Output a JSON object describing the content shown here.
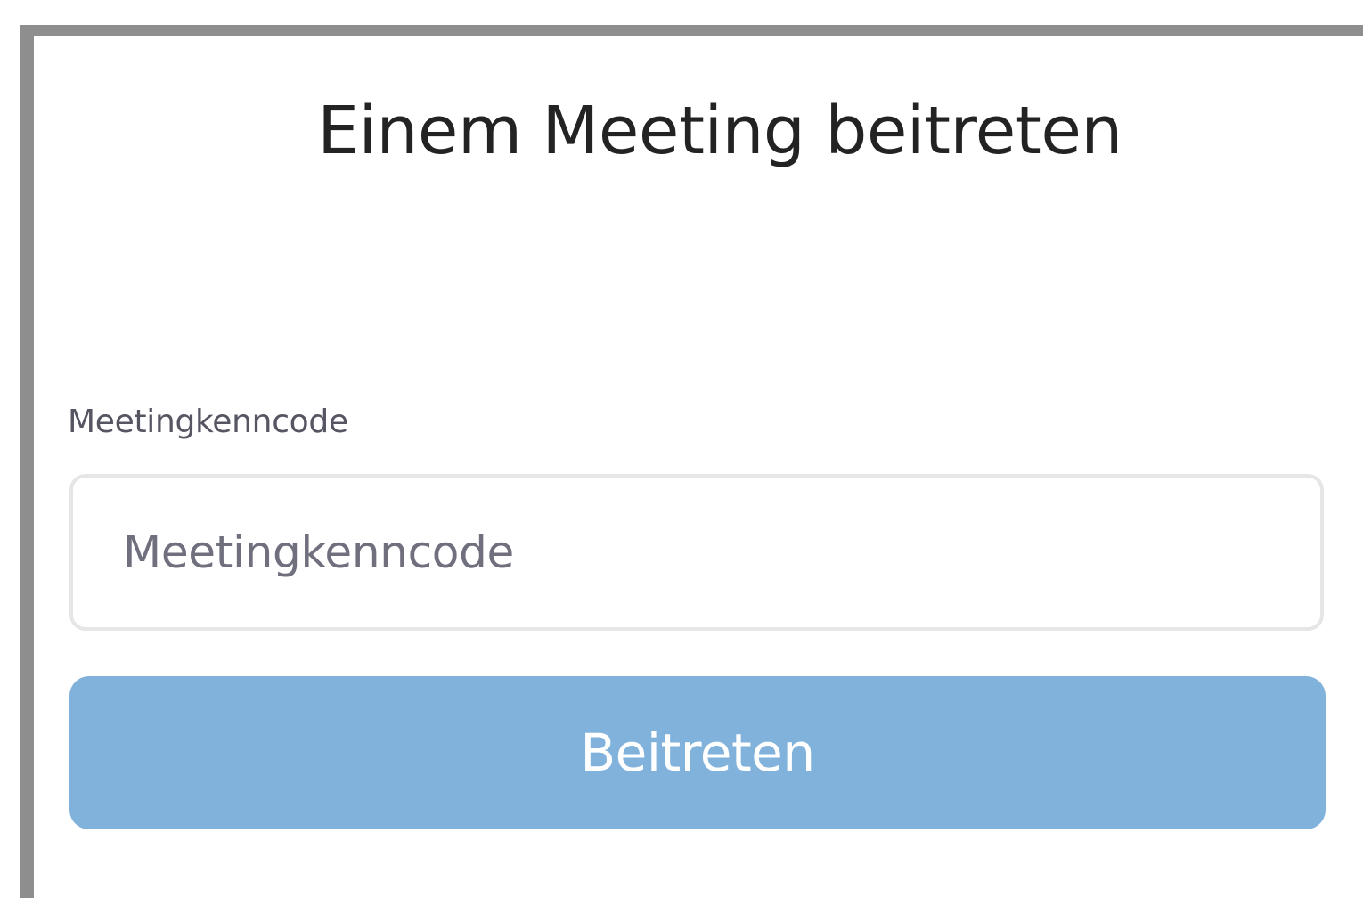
{
  "dialog": {
    "title": "Einem Meeting beitreten",
    "passcode_label": "Meetingkenncode",
    "passcode_input": {
      "value": "",
      "placeholder": "Meetingkenncode"
    },
    "join_button_label": "Beitreten"
  },
  "colors": {
    "frame": "#8e8e8e",
    "button_bg": "#80b2dc",
    "button_text": "#ffffff",
    "title_text": "#232323",
    "label_text": "#555662",
    "placeholder_text": "#6f6f7e",
    "input_border": "#e6e6e6"
  }
}
